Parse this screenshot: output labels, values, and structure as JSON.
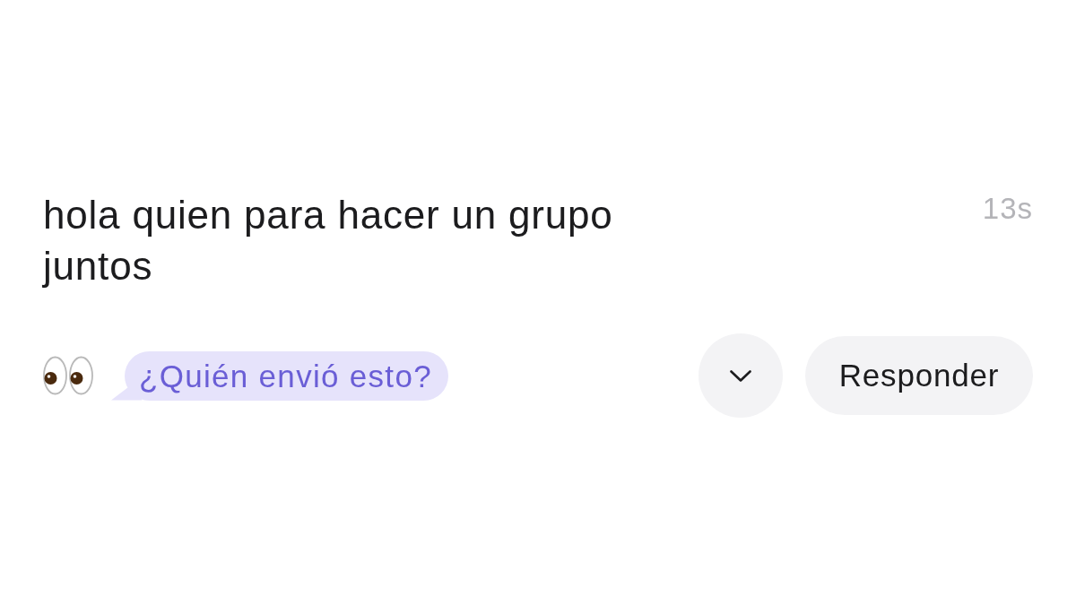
{
  "message": {
    "text": "hola quien para hacer un grupo juntos",
    "time": "13s"
  },
  "actions": {
    "who_sent": "¿Quién envió esto?",
    "reply": "Responder"
  }
}
